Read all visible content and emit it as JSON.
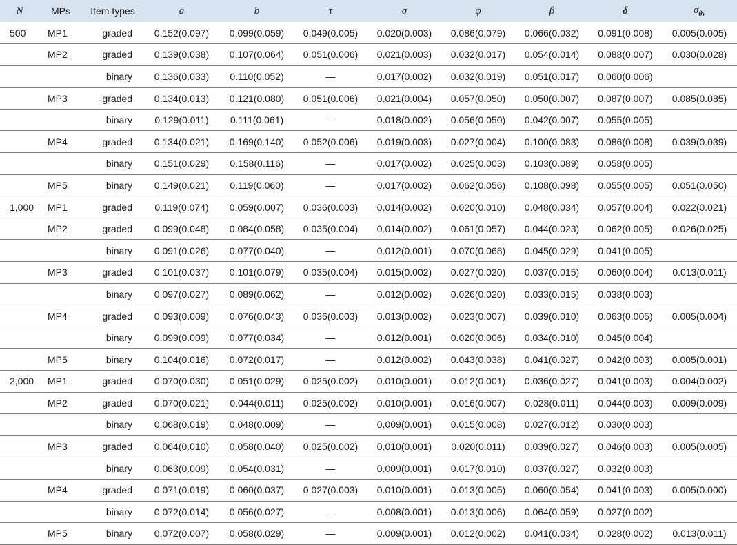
{
  "header": {
    "n": "N",
    "mps": "MPs",
    "item_types": "Item types",
    "a": "a",
    "b": "b",
    "tau": "τ",
    "sigma": "σ",
    "phi": "φ",
    "beta": "β",
    "delta": "δ",
    "sigma_theta_nu": "σθν"
  },
  "rows": [
    {
      "n": "500",
      "mp": "MP1",
      "type": "graded",
      "a": "0.152(0.097)",
      "b": "0.099(0.059)",
      "tau": "0.049(0.005)",
      "sigma": "0.020(0.003)",
      "phi": "0.086(0.079)",
      "beta": "0.066(0.032)",
      "delta": "0.091(0.008)",
      "stn": "0.005(0.005)"
    },
    {
      "n": "",
      "mp": "MP2",
      "type": "graded",
      "a": "0.139(0.038)",
      "b": "0.107(0.064)",
      "tau": "0.051(0.006)",
      "sigma": "0.021(0.003)",
      "phi": "0.032(0.017)",
      "beta": "0.054(0.014)",
      "delta": "0.088(0.007)",
      "stn": "0.030(0.028)"
    },
    {
      "n": "",
      "mp": "",
      "type": "binary",
      "a": "0.136(0.033)",
      "b": "0.110(0.052)",
      "tau": "—",
      "sigma": "0.017(0.002)",
      "phi": "0.032(0.019)",
      "beta": "0.051(0.017)",
      "delta": "0.060(0.006)",
      "stn": ""
    },
    {
      "n": "",
      "mp": "MP3",
      "type": "graded",
      "a": "0.134(0.013)",
      "b": "0.121(0.080)",
      "tau": "0.051(0.006)",
      "sigma": "0.021(0.004)",
      "phi": "0.057(0.050)",
      "beta": "0.050(0.007)",
      "delta": "0.087(0.007)",
      "stn": "0.085(0.085)"
    },
    {
      "n": "",
      "mp": "",
      "type": "binary",
      "a": "0.129(0.011)",
      "b": "0.111(0.061)",
      "tau": "—",
      "sigma": "0.018(0.002)",
      "phi": "0.056(0.050)",
      "beta": "0.042(0.007)",
      "delta": "0.055(0.005)",
      "stn": ""
    },
    {
      "n": "",
      "mp": "MP4",
      "type": "graded",
      "a": "0.134(0.021)",
      "b": "0.169(0.140)",
      "tau": "0.052(0.006)",
      "sigma": "0.019(0.003)",
      "phi": "0.027(0.004)",
      "beta": "0.100(0.083)",
      "delta": "0.086(0.008)",
      "stn": "0.039(0.039)"
    },
    {
      "n": "",
      "mp": "",
      "type": "binary",
      "a": "0.151(0.029)",
      "b": "0.158(0.116)",
      "tau": "—",
      "sigma": "0.017(0.002)",
      "phi": "0.025(0.003)",
      "beta": "0.103(0.089)",
      "delta": "0.058(0.005)",
      "stn": ""
    },
    {
      "n": "",
      "mp": "MP5",
      "type": "binary",
      "a": "0.149(0.021)",
      "b": "0.119(0.060)",
      "tau": "—",
      "sigma": "0.017(0.002)",
      "phi": "0.062(0.056)",
      "beta": "0.108(0.098)",
      "delta": "0.055(0.005)",
      "stn": "0.051(0.050)"
    },
    {
      "n": "1,000",
      "mp": "MP1",
      "type": "graded",
      "a": "0.119(0.074)",
      "b": "0.059(0.007)",
      "tau": "0.036(0.003)",
      "sigma": "0.014(0.002)",
      "phi": "0.020(0.010)",
      "beta": "0.048(0.034)",
      "delta": "0.057(0.004)",
      "stn": "0.022(0.021)"
    },
    {
      "n": "",
      "mp": "MP2",
      "type": "graded",
      "a": "0.099(0.048)",
      "b": "0.084(0.058)",
      "tau": "0.035(0.004)",
      "sigma": "0.014(0.002)",
      "phi": "0.061(0.057)",
      "beta": "0.044(0.023)",
      "delta": "0.062(0.005)",
      "stn": "0.026(0.025)"
    },
    {
      "n": "",
      "mp": "",
      "type": "binary",
      "a": "0.091(0.026)",
      "b": "0.077(0.040)",
      "tau": "—",
      "sigma": "0.012(0.001)",
      "phi": "0.070(0.068)",
      "beta": "0.045(0.029)",
      "delta": "0.041(0.005)",
      "stn": ""
    },
    {
      "n": "",
      "mp": "MP3",
      "type": "graded",
      "a": "0.101(0.037)",
      "b": "0.101(0.079)",
      "tau": "0.035(0.004)",
      "sigma": "0.015(0.002)",
      "phi": "0.027(0.020)",
      "beta": "0.037(0.015)",
      "delta": "0.060(0.004)",
      "stn": "0.013(0.011)"
    },
    {
      "n": "",
      "mp": "",
      "type": "binary",
      "a": "0.097(0.027)",
      "b": "0.089(0.062)",
      "tau": "—",
      "sigma": "0.012(0.002)",
      "phi": "0.026(0.020)",
      "beta": "0.033(0.015)",
      "delta": "0.038(0.003)",
      "stn": ""
    },
    {
      "n": "",
      "mp": "MP4",
      "type": "graded",
      "a": "0.093(0.009)",
      "b": "0.076(0.043)",
      "tau": "0.036(0.003)",
      "sigma": "0.013(0.002)",
      "phi": "0.023(0.007)",
      "beta": "0.039(0.010)",
      "delta": "0.063(0.005)",
      "stn": "0.005(0.004)"
    },
    {
      "n": "",
      "mp": "",
      "type": "binary",
      "a": "0.099(0.009)",
      "b": "0.077(0.034)",
      "tau": "—",
      "sigma": "0.012(0.001)",
      "phi": "0.020(0.006)",
      "beta": "0.034(0.010)",
      "delta": "0.045(0.004)",
      "stn": ""
    },
    {
      "n": "",
      "mp": "MP5",
      "type": "binary",
      "a": "0.104(0.016)",
      "b": "0.072(0.017)",
      "tau": "—",
      "sigma": "0.012(0.002)",
      "phi": "0.043(0.038)",
      "beta": "0.041(0.027)",
      "delta": "0.042(0.003)",
      "stn": "0.005(0.001)"
    },
    {
      "n": "2,000",
      "mp": "MP1",
      "type": "graded",
      "a": "0.070(0.030)",
      "b": "0.051(0.029)",
      "tau": "0.025(0.002)",
      "sigma": "0.010(0.001)",
      "phi": "0.012(0.001)",
      "beta": "0.036(0.027)",
      "delta": "0.041(0.003)",
      "stn": "0.004(0.002)"
    },
    {
      "n": "",
      "mp": "MP2",
      "type": "graded",
      "a": "0.070(0.021)",
      "b": "0.044(0.011)",
      "tau": "0.025(0.002)",
      "sigma": "0.010(0.001)",
      "phi": "0.016(0.007)",
      "beta": "0.028(0.011)",
      "delta": "0.044(0.003)",
      "stn": "0.009(0.009)"
    },
    {
      "n": "",
      "mp": "",
      "type": "binary",
      "a": "0.068(0.019)",
      "b": "0.048(0.009)",
      "tau": "—",
      "sigma": "0.009(0.001)",
      "phi": "0.015(0.008)",
      "beta": "0.027(0.012)",
      "delta": "0.030(0.003)",
      "stn": ""
    },
    {
      "n": "",
      "mp": "MP3",
      "type": "graded",
      "a": "0.064(0.010)",
      "b": "0.058(0.040)",
      "tau": "0.025(0.002)",
      "sigma": "0.010(0.001)",
      "phi": "0.020(0.011)",
      "beta": "0.039(0.027)",
      "delta": "0.046(0.003)",
      "stn": "0.005(0.005)"
    },
    {
      "n": "",
      "mp": "",
      "type": "binary",
      "a": "0.063(0.009)",
      "b": "0.054(0.031)",
      "tau": "—",
      "sigma": "0.009(0.001)",
      "phi": "0.017(0.010)",
      "beta": "0.037(0.027)",
      "delta": "0.032(0.003)",
      "stn": ""
    },
    {
      "n": "",
      "mp": "MP4",
      "type": "graded",
      "a": "0.071(0.019)",
      "b": "0.060(0.037)",
      "tau": "0.027(0.003)",
      "sigma": "0.010(0.001)",
      "phi": "0.013(0.005)",
      "beta": "0.060(0.054)",
      "delta": "0.041(0.003)",
      "stn": "0.005(0.000)"
    },
    {
      "n": "",
      "mp": "",
      "type": "binary",
      "a": "0.072(0.014)",
      "b": "0.056(0.027)",
      "tau": "—",
      "sigma": "0.008(0.001)",
      "phi": "0.013(0.006)",
      "beta": "0.064(0.059)",
      "delta": "0.027(0.002)",
      "stn": ""
    },
    {
      "n": "",
      "mp": "MP5",
      "type": "binary",
      "a": "0.072(0.007)",
      "b": "0.058(0.029)",
      "tau": "—",
      "sigma": "0.009(0.001)",
      "phi": "0.012(0.002)",
      "beta": "0.041(0.034)",
      "delta": "0.028(0.002)",
      "stn": "0.013(0.011)"
    }
  ]
}
